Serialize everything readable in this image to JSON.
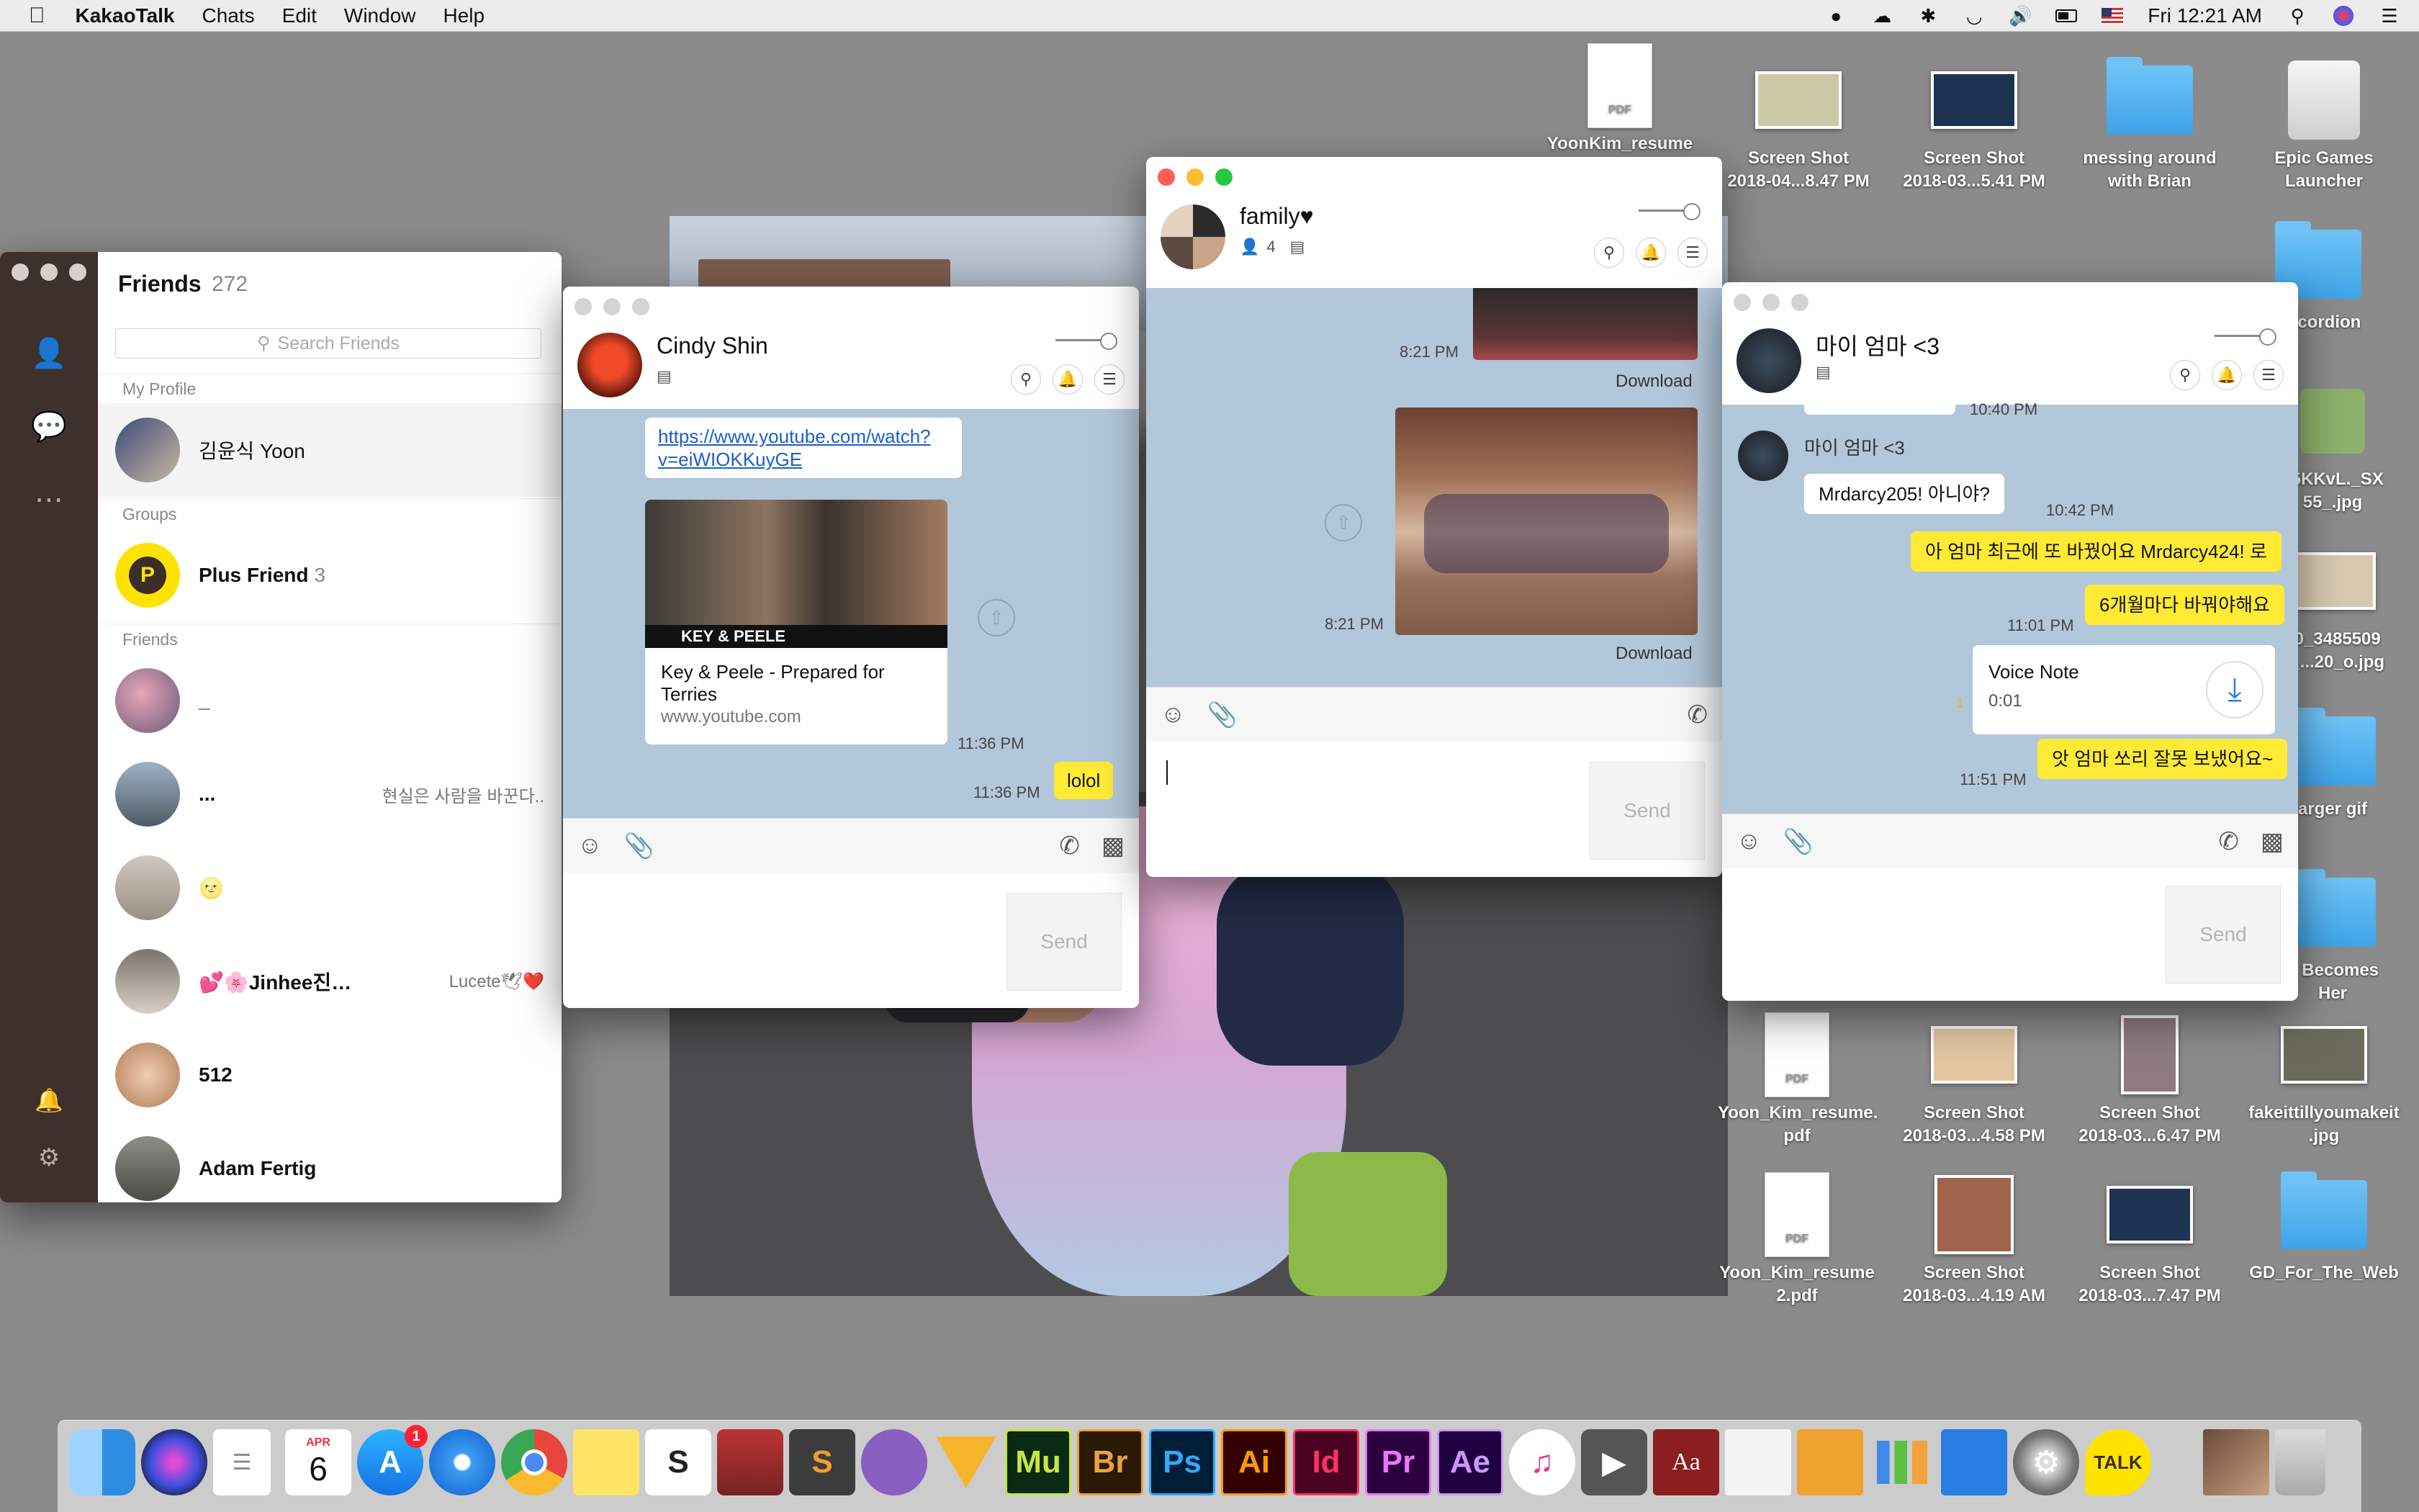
{
  "menubar": {
    "app": "KakaoTalk",
    "items": [
      "Chats",
      "Edit",
      "Window",
      "Help"
    ],
    "clock": "Fri 12:21 AM"
  },
  "desktop": {
    "icons": [
      {
        "label": "YoonKim_resume",
        "kind": "pdf"
      },
      {
        "label": "Screen Shot\n2018-04...8.47 PM",
        "kind": "thumb"
      },
      {
        "label": "Screen Shot\n2018-03...5.41 PM",
        "kind": "thumb"
      },
      {
        "label": "messing around\nwith Brian",
        "kind": "folder"
      },
      {
        "label": "Epic Games\nLauncher",
        "kind": "drive"
      },
      {
        "label": "Accordion",
        "kind": "folder"
      },
      {
        "label": "95KKvL._SX\n55_.jpg",
        "kind": "thumb"
      },
      {
        "label": "70_3485509\n7_...20_o.jpg",
        "kind": "thumb"
      },
      {
        "label": "arger gif",
        "kind": "folder"
      },
      {
        "label": "h Becomes\nHer",
        "kind": "folder"
      },
      {
        "label": "Yoon_Kim_resume.\npdf",
        "kind": "pdf"
      },
      {
        "label": "Screen Shot\n2018-03...4.58 PM",
        "kind": "thumb"
      },
      {
        "label": "Screen Shot\n2018-03...6.47 PM",
        "kind": "thumb"
      },
      {
        "label": "fakeittillyoumakeit\n.jpg",
        "kind": "thumb"
      },
      {
        "label": "Yoon_Kim_resume\n2.pdf",
        "kind": "pdf"
      },
      {
        "label": "Screen Shot\n2018-03...4.19 AM",
        "kind": "thumb"
      },
      {
        "label": "Screen Shot\n2018-03...7.47 PM",
        "kind": "thumb"
      },
      {
        "label": "GD_For_The_Web",
        "kind": "folder"
      }
    ]
  },
  "friends": {
    "title": "Friends",
    "count": "272",
    "search_placeholder": "Search Friends",
    "sections": {
      "profile": "My Profile",
      "groups": "Groups",
      "friends": "Friends"
    },
    "my_profile": "김윤식 Yoon",
    "plus_friend": "Plus Friend",
    "plus_count": "3",
    "list": [
      {
        "name": "_",
        "status": ""
      },
      {
        "name": "...",
        "status": "현실은 사람을 바꾼다.."
      },
      {
        "name": "🌝",
        "status": ""
      },
      {
        "name": "💕🌸Jinhee진…",
        "status": "Lucete🕊❤️"
      },
      {
        "name": "512",
        "status": ""
      },
      {
        "name": "Adam Fertig",
        "status": ""
      }
    ]
  },
  "chat_cindy": {
    "name": "Cindy Shin",
    "link": "https://www.youtube.com/watch?v=eiWIOKKuyGE",
    "link_line1": "https://www.youtube.com/watch?",
    "link_line2": "v=eiWIOKKuyGE",
    "preview_title_line1": "Key & Peele - Prepared for",
    "preview_title_line2": "Terries",
    "preview_site": "www.youtube.com",
    "preview_banner": "KEY & PEELE",
    "time1": "11:36 PM",
    "time2": "11:36 PM",
    "my_msg": "lolol",
    "send": "Send"
  },
  "chat_family": {
    "name": "family♥",
    "members": "4",
    "time1": "8:21 PM",
    "download1": "Download",
    "time2": "8:21 PM",
    "download2": "Download",
    "send": "Send"
  },
  "chat_mom": {
    "name": "마이 엄마 <3",
    "time0": "10:40 PM",
    "sender": "마이 엄마 <3",
    "msg1": "Mrdarcy205! 아니야?",
    "time1": "10:42 PM",
    "reply1": "아 엄마 최근에 또 바꿨어요 Mrdarcy424! 로",
    "reply2": "6개월마다 바꿔야해요",
    "time2": "11:01 PM",
    "voice_title": "Voice Note",
    "voice_len": "0:01",
    "reply3": "앗 엄마 쏘리 잘못 보냈어요~",
    "time3": "11:51 PM",
    "unread": "1",
    "send": "Send"
  },
  "dock": {
    "calendar_month": "APR",
    "calendar_day": "6",
    "appstore_badge": "1",
    "apps": [
      "Finder",
      "Siri",
      "Reminders",
      "Calendar",
      "App Store",
      "Safari",
      "Chrome",
      "Notes",
      "Slack",
      "Photo Booth",
      "Sublime Text",
      "GitHub Desktop",
      "Sketch",
      "Muse",
      "Bridge",
      "Photoshop",
      "Illustrator",
      "InDesign",
      "Premiere",
      "After Effects",
      "iTunes",
      "QuickTime",
      "Dictionary",
      "TextEdit",
      "Pages",
      "Numbers",
      "Keynote",
      "System Preferences",
      "KakaoTalk",
      "Photos",
      "Trash"
    ],
    "labels": {
      "mu": "Mu",
      "br": "Br",
      "ps": "Ps",
      "ai": "Ai",
      "id": "Id",
      "pr": "Pr",
      "ae": "Ae",
      "aa": "Aa",
      "talk": "TALK",
      "s": "S"
    }
  }
}
